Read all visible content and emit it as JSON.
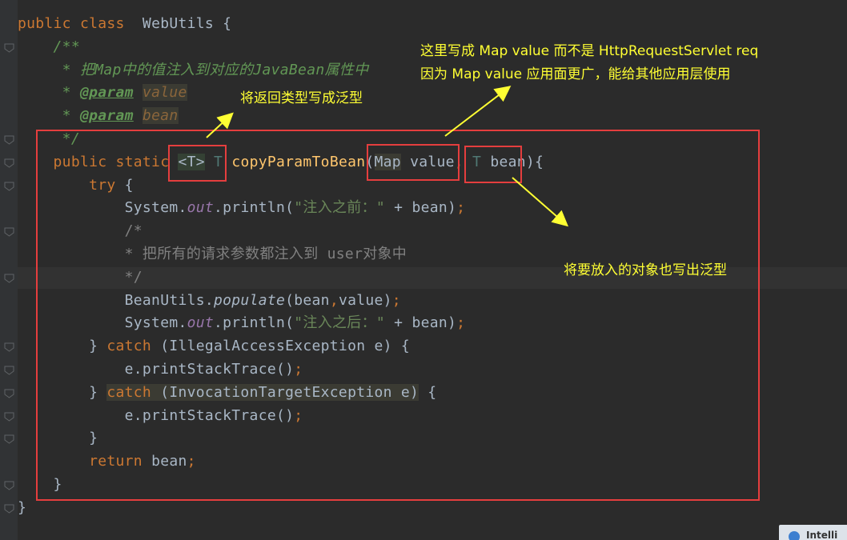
{
  "code_lines": [
    [
      {
        "t": "public class",
        "c": "kw"
      },
      {
        "t": "  WebUtils {",
        "c": ""
      }
    ],
    [
      {
        "t": "    /**",
        "c": "jd"
      }
    ],
    [
      {
        "t": "     * 把Map中的值注入到对应的JavaBean属性中",
        "c": "jd"
      }
    ],
    [
      {
        "t": "     * ",
        "c": "jd"
      },
      {
        "t": "@param",
        "c": "tag"
      },
      {
        "t": " ",
        "c": "jd"
      },
      {
        "t": "value",
        "c": "jp"
      }
    ],
    [
      {
        "t": "     * ",
        "c": "jd"
      },
      {
        "t": "@param",
        "c": "tag"
      },
      {
        "t": " ",
        "c": "jd"
      },
      {
        "t": "bean",
        "c": "jp"
      }
    ],
    [
      {
        "t": "     */",
        "c": "jd"
      }
    ],
    [
      {
        "t": "    public static ",
        "c": "kw"
      },
      {
        "t": "<T>",
        "c": "hl"
      },
      {
        "t": " ",
        "c": ""
      },
      {
        "t": "T",
        "c": "tp"
      },
      {
        "t": " ",
        "c": ""
      },
      {
        "t": "copyParamToBean",
        "c": "fn"
      },
      {
        "t": "(",
        "c": ""
      },
      {
        "t": "Map",
        "c": "hl2"
      },
      {
        "t": " value",
        "c": ""
      },
      {
        "t": ", ",
        "c": "kw"
      },
      {
        "t": "T",
        "c": "tp"
      },
      {
        "t": " bean){",
        "c": ""
      }
    ],
    [
      {
        "t": "        ",
        "c": ""
      },
      {
        "t": "try",
        "c": "kw"
      },
      {
        "t": " {",
        "c": ""
      }
    ],
    [
      {
        "t": "            System.",
        "c": ""
      },
      {
        "t": "out",
        "c": "it"
      },
      {
        "t": ".println(",
        "c": ""
      },
      {
        "t": "\"注入之前：\"",
        "c": "st"
      },
      {
        "t": " + bean)",
        "c": ""
      },
      {
        "t": ";",
        "c": "kw"
      }
    ],
    [
      {
        "t": "            /*",
        "c": "cm"
      }
    ],
    [
      {
        "t": "            * 把所有的请求参数都注入到 user对象中",
        "c": "cm"
      }
    ],
    [
      {
        "t": "            */",
        "c": "cm"
      }
    ],
    [
      {
        "t": "            BeanUtils.",
        "c": ""
      },
      {
        "t": "populate",
        "c": "it2"
      },
      {
        "t": "(bean",
        "c": ""
      },
      {
        "t": ",",
        "c": "kw"
      },
      {
        "t": "value)",
        "c": ""
      },
      {
        "t": ";",
        "c": "kw"
      }
    ],
    [
      {
        "t": "            System.",
        "c": ""
      },
      {
        "t": "out",
        "c": "it"
      },
      {
        "t": ".println(",
        "c": ""
      },
      {
        "t": "\"注入之后：\"",
        "c": "st"
      },
      {
        "t": " + bean)",
        "c": ""
      },
      {
        "t": ";",
        "c": "kw"
      }
    ],
    [
      {
        "t": "        } ",
        "c": ""
      },
      {
        "t": "catch",
        "c": "kw"
      },
      {
        "t": " (IllegalAccessException e) {",
        "c": ""
      }
    ],
    [
      {
        "t": "            e.printStackTrace()",
        "c": ""
      },
      {
        "t": ";",
        "c": "kw"
      }
    ],
    [
      {
        "t": "        } ",
        "c": ""
      },
      {
        "t": "catch",
        "c": "kw hl2"
      },
      {
        "t": " (InvocationTargetException e)",
        "c": "hl2"
      },
      {
        "t": " {",
        "c": ""
      }
    ],
    [
      {
        "t": "            e.printStackTrace()",
        "c": ""
      },
      {
        "t": ";",
        "c": "kw"
      }
    ],
    [
      {
        "t": "        }",
        "c": ""
      }
    ],
    [
      {
        "t": "        ",
        "c": ""
      },
      {
        "t": "return",
        "c": "kw"
      },
      {
        "t": " bean",
        "c": ""
      },
      {
        "t": ";",
        "c": "kw"
      }
    ],
    [
      {
        "t": "    }",
        "c": ""
      }
    ],
    [
      {
        "t": "}",
        "c": ""
      }
    ]
  ],
  "annotations": {
    "return_type": "将返回类型写成泛型",
    "map_value_line1": "这里写成 Map value 而不是 HttpRequestServlet req",
    "map_value_line2": "因为 Map value 应用面更广，能给其他应用层使用",
    "bean_param": "将要放入的对象也写出泛型"
  },
  "popup": {
    "label": "Intelli"
  },
  "colors": {
    "background": "#2b2b2b",
    "keyword": "#cc7832",
    "method": "#ffc66d",
    "string": "#6a8759",
    "javadoc": "#629755",
    "annotation_text": "#ffff33",
    "box": "#e53e3e"
  }
}
